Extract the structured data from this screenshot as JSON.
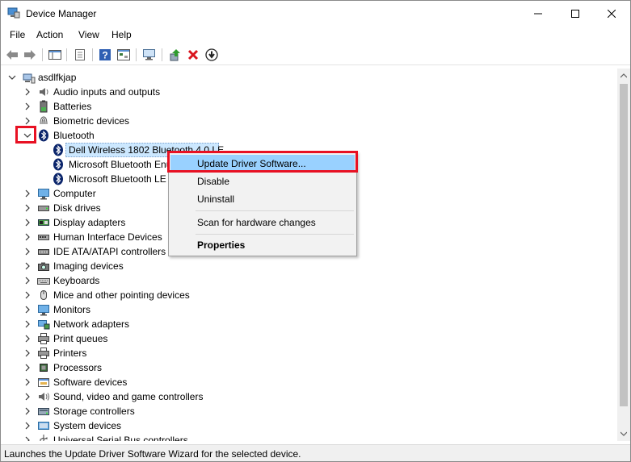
{
  "window": {
    "title": "Device Manager",
    "controls": {
      "minimize": "minimize-icon",
      "maximize": "maximize-icon",
      "close": "close-icon"
    }
  },
  "menu": [
    "File",
    "Action",
    "View",
    "Help"
  ],
  "toolbar": {
    "buttons": [
      "back-icon",
      "forward-icon",
      "show-hide-tree-icon",
      "properties-icon",
      "help-icon",
      "resources-view-icon",
      "display-computer-icon",
      "update-driver-icon",
      "uninstall-icon",
      "download-icon"
    ]
  },
  "tree": {
    "root": "asdlfkjap",
    "categories": [
      {
        "label": "Audio inputs and outputs",
        "icon": "speaker-icon"
      },
      {
        "label": "Batteries",
        "icon": "battery-icon"
      },
      {
        "label": "Biometric devices",
        "icon": "fingerprint-icon"
      },
      {
        "label": "Bluetooth",
        "icon": "bluetooth-icon",
        "expanded": true,
        "children": [
          {
            "label": "Dell Wireless 1802 Bluetooth 4.0 LE",
            "selected": true
          },
          {
            "label": "Microsoft Bluetooth Enu"
          },
          {
            "label": "Microsoft Bluetooth LE"
          }
        ]
      },
      {
        "label": "Computer",
        "icon": "monitor-icon"
      },
      {
        "label": "Disk drives",
        "icon": "disk-icon"
      },
      {
        "label": "Display adapters",
        "icon": "display-adapter-icon"
      },
      {
        "label": "Human Interface Devices",
        "icon": "hid-icon"
      },
      {
        "label": "IDE ATA/ATAPI controllers",
        "icon": "ide-icon"
      },
      {
        "label": "Imaging devices",
        "icon": "camera-icon"
      },
      {
        "label": "Keyboards",
        "icon": "keyboard-icon"
      },
      {
        "label": "Mice and other pointing devices",
        "icon": "mouse-icon"
      },
      {
        "label": "Monitors",
        "icon": "monitor-icon"
      },
      {
        "label": "Network adapters",
        "icon": "network-icon"
      },
      {
        "label": "Print queues",
        "icon": "printer-icon"
      },
      {
        "label": "Printers",
        "icon": "printer-icon"
      },
      {
        "label": "Processors",
        "icon": "processor-icon"
      },
      {
        "label": "Software devices",
        "icon": "software-device-icon"
      },
      {
        "label": "Sound, video and game controllers",
        "icon": "sound-icon"
      },
      {
        "label": "Storage controllers",
        "icon": "storage-icon"
      },
      {
        "label": "System devices",
        "icon": "system-device-icon"
      },
      {
        "label": "Universal Serial Bus controllers",
        "icon": "usb-icon"
      }
    ]
  },
  "context_menu": {
    "items": [
      {
        "label": "Update Driver Software...",
        "highlighted": true
      },
      {
        "label": "Disable"
      },
      {
        "label": "Uninstall"
      },
      {
        "label": "Scan for hardware changes"
      },
      {
        "label": "Properties",
        "bold": true
      }
    ]
  },
  "status": "Launches the Update Driver Software Wizard for the selected device.",
  "colors": {
    "highlight": "#99d1ff",
    "selection": "#cce8ff",
    "annotation": "#e81123",
    "bluetooth": "#0a246a"
  }
}
